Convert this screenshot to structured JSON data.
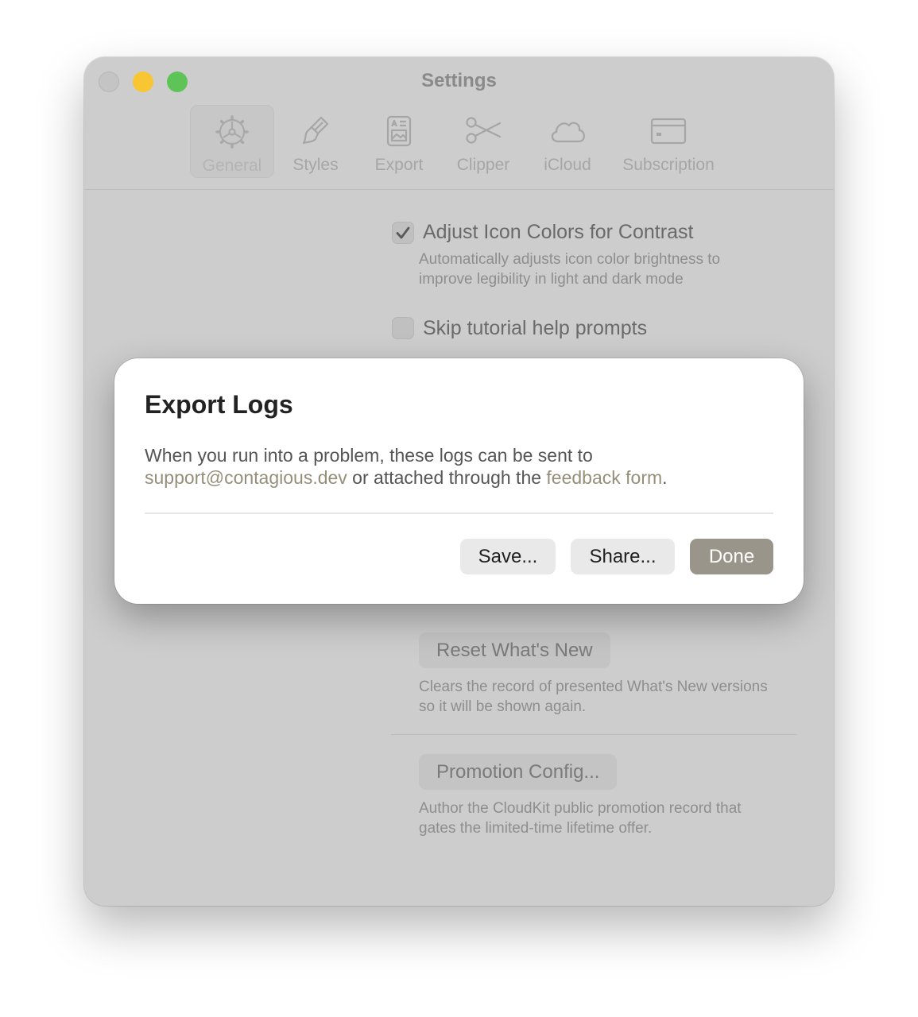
{
  "window": {
    "title": "Settings"
  },
  "toolbar": {
    "tabs": [
      {
        "label": "General",
        "icon": "gear-icon",
        "active": true
      },
      {
        "label": "Styles",
        "icon": "paintbrush-icon"
      },
      {
        "label": "Export",
        "icon": "document-icon"
      },
      {
        "label": "Clipper",
        "icon": "scissors-icon"
      },
      {
        "label": "iCloud",
        "icon": "cloud-icon"
      },
      {
        "label": "Subscription",
        "icon": "credit-card-icon"
      }
    ]
  },
  "general": {
    "adjust_icon_colors": {
      "label": "Adjust Icon Colors for Contrast",
      "checked": true,
      "description_line1": "Automatically adjusts icon color brightness to",
      "description_line2": "improve legibility in light and dark mode"
    },
    "skip_tutorial": {
      "label": "Skip tutorial help prompts",
      "checked": false
    },
    "reset_whats_new": {
      "button": "Reset What's New",
      "description_line1": "Clears the record of presented What's New versions",
      "description_line2": "so it will be shown again."
    },
    "promotion_config": {
      "button": "Promotion Config...",
      "description_line1": "Author the CloudKit public promotion record that",
      "description_line2": "gates the limited-time lifetime offer."
    }
  },
  "sheet": {
    "title": "Export Logs",
    "body_prefix": "When you run into a problem, these logs can be sent to",
    "email_link": "support@contagious.dev",
    "body_middle": " or attached through the ",
    "feedback_link": "feedback form",
    "body_suffix": ".",
    "buttons": {
      "save": "Save...",
      "share": "Share...",
      "done": "Done"
    }
  },
  "colors": {
    "window_bg": "#cdcdcd",
    "sheet_bg": "#ffffff",
    "accent": "#9a958b",
    "link": "#958f7a",
    "traffic_close": "#c4c4c4",
    "traffic_minimize": "#f7c632",
    "traffic_maximize": "#5ec458"
  }
}
